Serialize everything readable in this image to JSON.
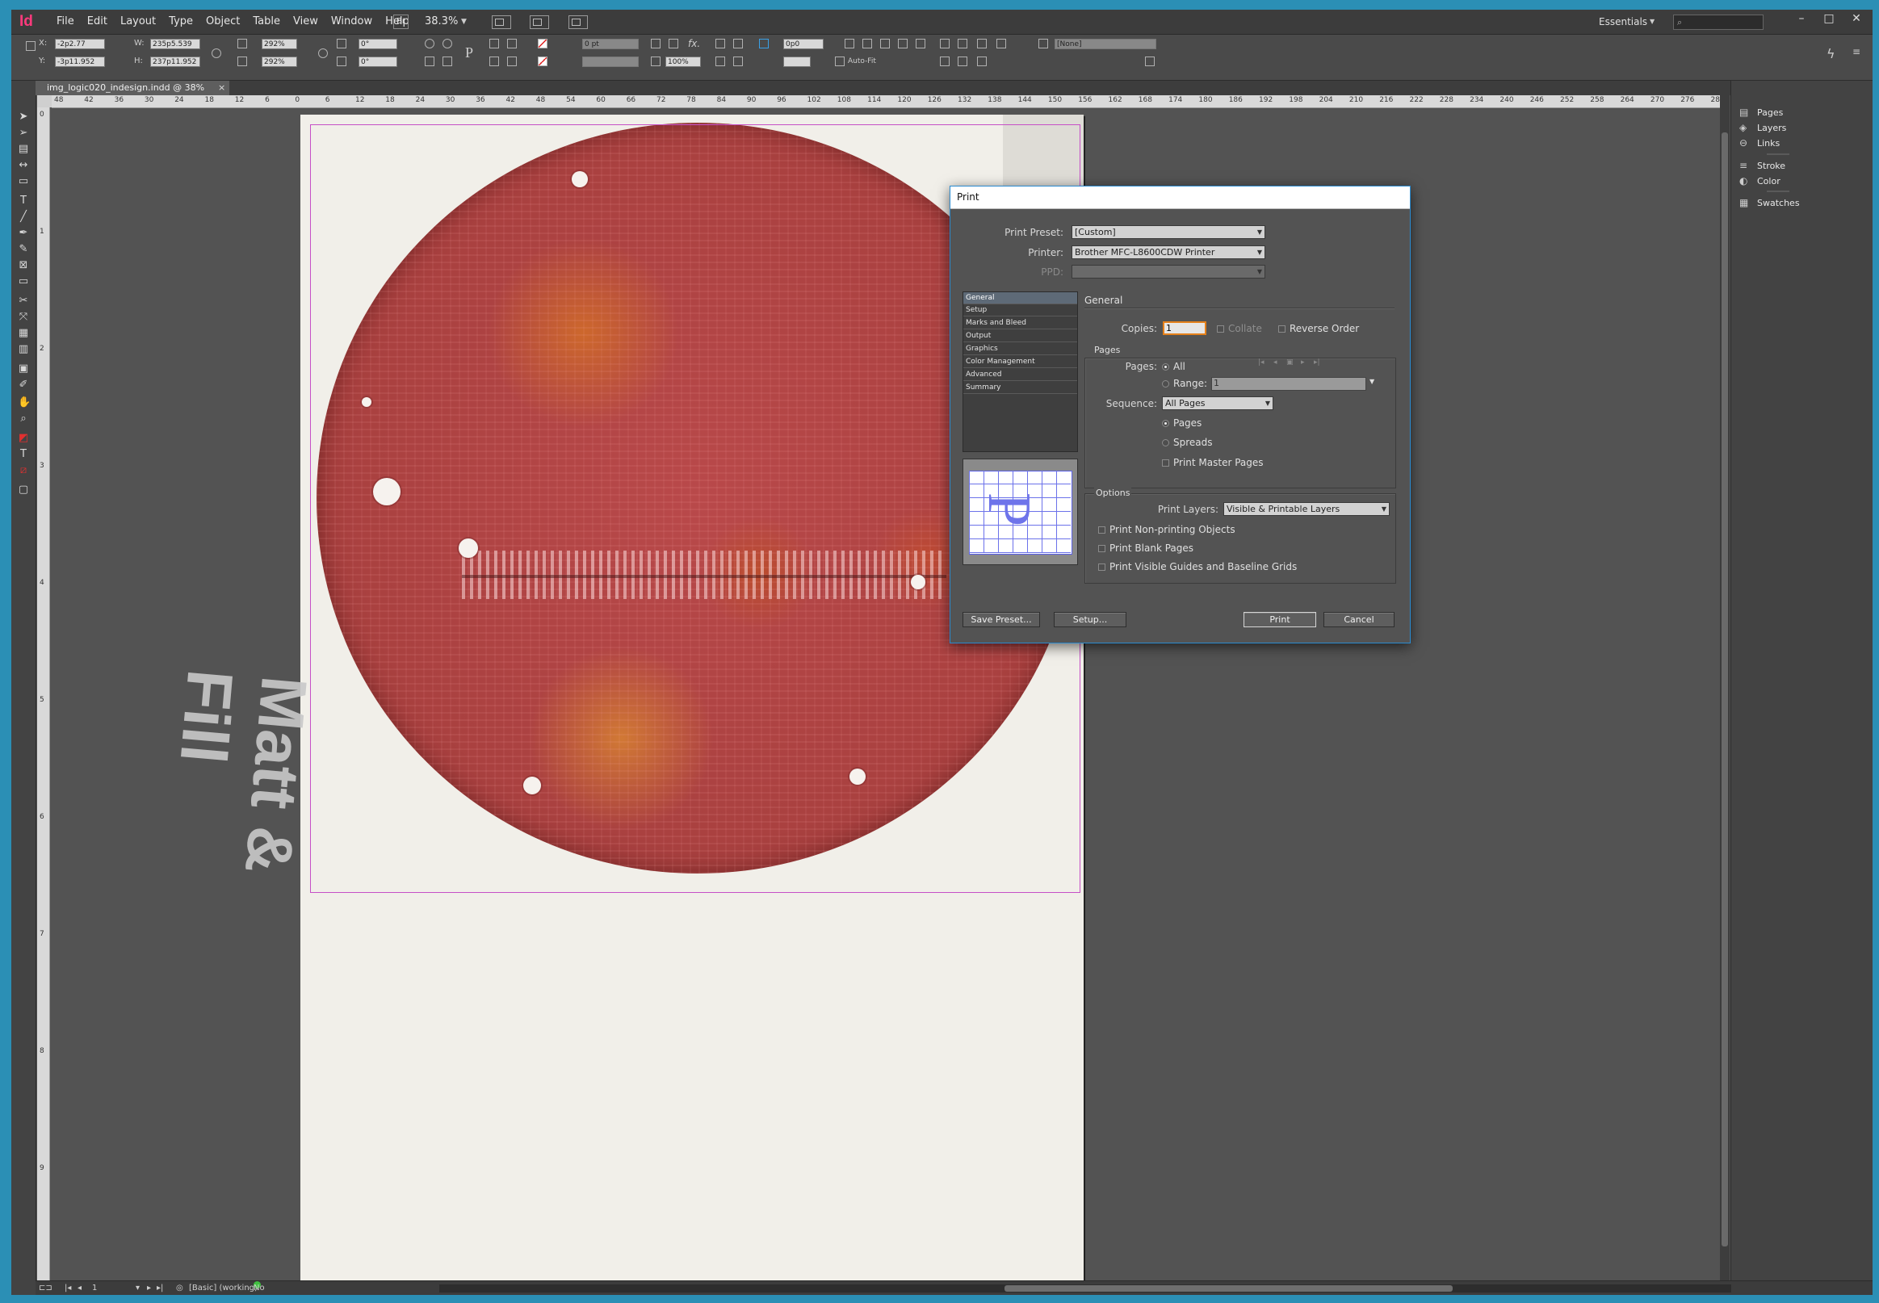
{
  "app": {
    "logo": "Id",
    "menu": [
      "File",
      "Edit",
      "Layout",
      "Type",
      "Object",
      "Table",
      "View",
      "Window",
      "Help"
    ],
    "bridge": "Br",
    "zoom": "38.3%",
    "workspace": "Essentials",
    "search_placeholder": ""
  },
  "controlbar": {
    "x_label": "X:",
    "x_value": "-2p2.77",
    "y_label": "Y:",
    "y_value": "-3p11.952",
    "w_label": "W:",
    "w_value": "235p5.539",
    "h_label": "H:",
    "h_value": "237p11.952",
    "scale_x": "292%",
    "scale_y": "292%",
    "rotate": "0°",
    "shear": "0°",
    "stroke_weight": "0 pt",
    "opacity": "100%",
    "offset": "0p0",
    "autofit": "Auto-Fit",
    "object_style": "[None]"
  },
  "document": {
    "tab_title": "img_logic020_indesign.indd @ 38%",
    "tab_close": "×",
    "ruler_h": [
      "48",
      "42",
      "36",
      "30",
      "24",
      "18",
      "12",
      "6",
      "0",
      "6",
      "12",
      "18",
      "24",
      "30",
      "36",
      "42",
      "48",
      "54",
      "60",
      "66",
      "72",
      "78",
      "84",
      "90",
      "96",
      "102",
      "108",
      "114",
      "120",
      "126",
      "132",
      "138",
      "144",
      "150",
      "156",
      "162",
      "168",
      "174",
      "180",
      "186",
      "192",
      "198",
      "204",
      "210",
      "216",
      "222",
      "228",
      "234",
      "240",
      "246",
      "252",
      "258",
      "264",
      "270",
      "276",
      "282"
    ],
    "ruler_v": [
      "0",
      "1",
      "2",
      "3",
      "4",
      "5",
      "6",
      "7",
      "8",
      "9"
    ]
  },
  "panels": [
    {
      "label": "Pages",
      "icon": "pages-icon"
    },
    {
      "label": "Layers",
      "icon": "layers-icon"
    },
    {
      "label": "Links",
      "icon": "links-icon"
    },
    {
      "label": "Stroke",
      "icon": "stroke-icon"
    },
    {
      "label": "Color",
      "icon": "color-icon"
    },
    {
      "label": "Swatches",
      "icon": "swatches-icon"
    }
  ],
  "status": {
    "page": "1",
    "style": "[Basic] (working)",
    "preflight": "No errors"
  },
  "print_dialog": {
    "title": "Print",
    "preset_label": "Print Preset:",
    "preset_value": "[Custom]",
    "printer_label": "Printer:",
    "printer_value": "Brother MFC-L8600CDW Printer",
    "ppd_label": "PPD:",
    "categories": [
      "General",
      "Setup",
      "Marks and Bleed",
      "Output",
      "Graphics",
      "Color Management",
      "Advanced",
      "Summary"
    ],
    "selected_category": "General",
    "section_title": "General",
    "copies_label": "Copies:",
    "copies_value": "1",
    "collate": "Collate",
    "reverse_order": "Reverse Order",
    "pages_group": "Pages",
    "pages_label": "Pages:",
    "all": "All",
    "range_label": "Range:",
    "range_value": "1",
    "sequence_label": "Sequence:",
    "sequence_value": "All Pages",
    "pages_opt": "Pages",
    "spreads_opt": "Spreads",
    "master_pages": "Print Master Pages",
    "options_group": "Options",
    "print_layers_label": "Print Layers:",
    "print_layers_value": "Visible & Printable Layers",
    "nonprinting": "Print Non-printing Objects",
    "blank_pages": "Print Blank Pages",
    "guides": "Print Visible Guides and Baseline Grids",
    "save_preset": "Save Preset...",
    "setup": "Setup...",
    "print": "Print",
    "cancel": "Cancel",
    "preview_glyph": "P"
  }
}
